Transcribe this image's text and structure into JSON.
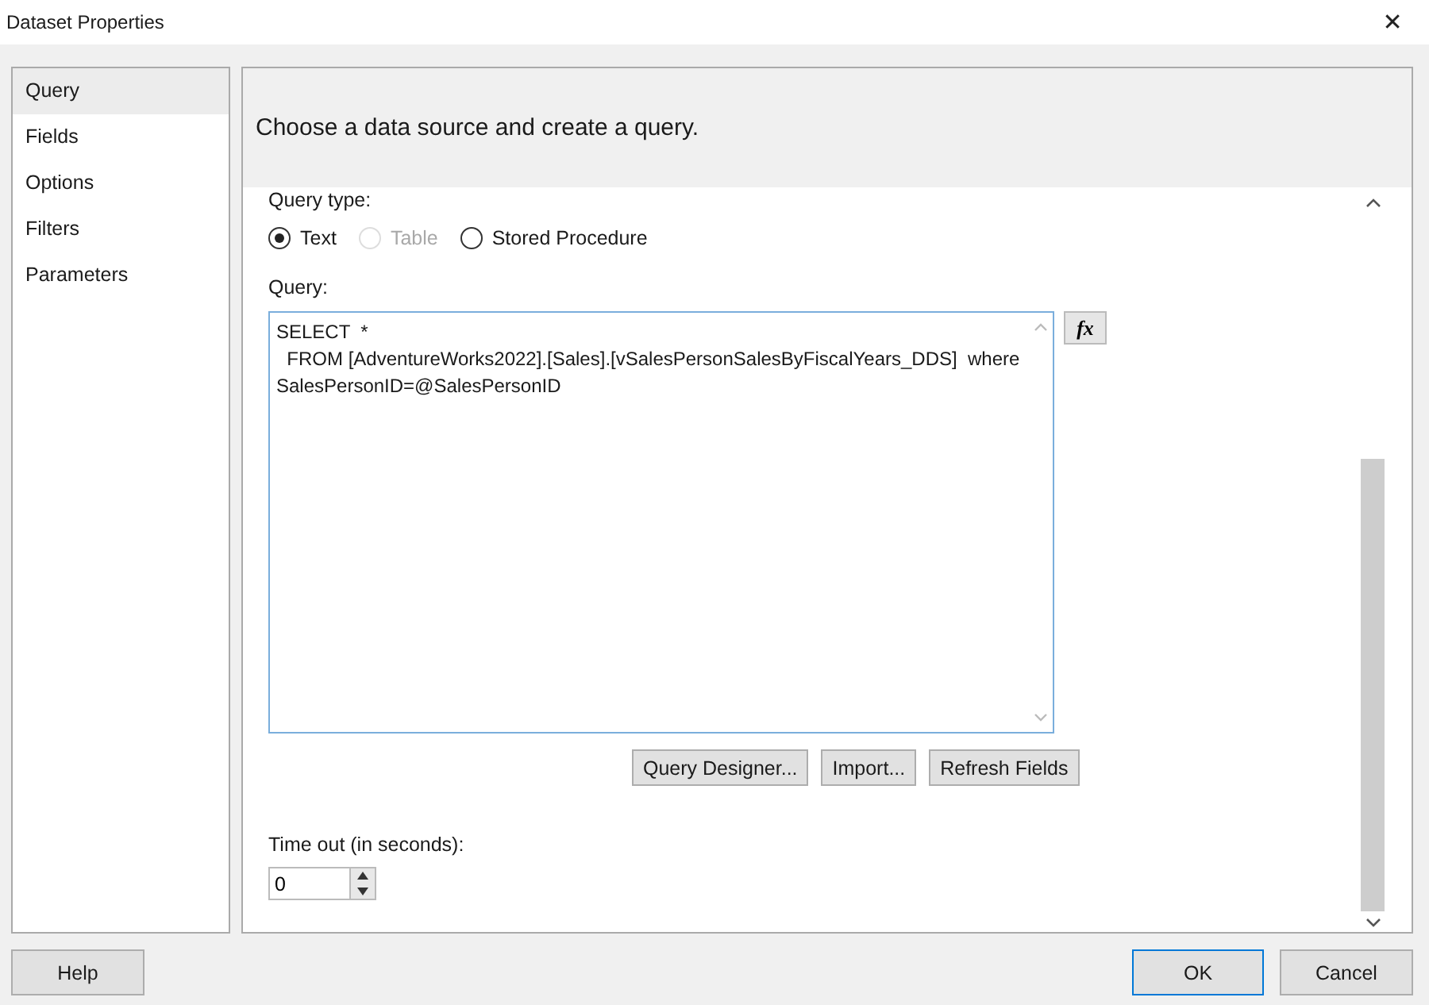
{
  "window": {
    "title": "Dataset Properties",
    "close": "✕"
  },
  "sidebar": {
    "items": [
      {
        "label": "Query",
        "selected": true
      },
      {
        "label": "Fields",
        "selected": false
      },
      {
        "label": "Options",
        "selected": false
      },
      {
        "label": "Filters",
        "selected": false
      },
      {
        "label": "Parameters",
        "selected": false
      }
    ]
  },
  "header": "Choose a data source and create a query.",
  "query_type": {
    "label": "Query type:",
    "options": [
      {
        "label": "Text",
        "selected": true,
        "disabled": false
      },
      {
        "label": "Table",
        "selected": false,
        "disabled": true
      },
      {
        "label": "Stored Procedure",
        "selected": false,
        "disabled": false
      }
    ]
  },
  "query": {
    "label": "Query:",
    "lines": [
      "SELECT  *",
      "  FROM [AdventureWorks2022].[Sales].[vSalesPersonSalesByFiscalYears_DDS]  where",
      "SalesPersonID=@SalesPersonID"
    ],
    "function_button": "fx"
  },
  "query_buttons": [
    "Query Designer...",
    "Import...",
    "Refresh Fields"
  ],
  "timeout": {
    "label": "Time out (in seconds):",
    "value": "0"
  },
  "footer": {
    "help": "Help",
    "ok": "OK",
    "cancel": "Cancel"
  }
}
